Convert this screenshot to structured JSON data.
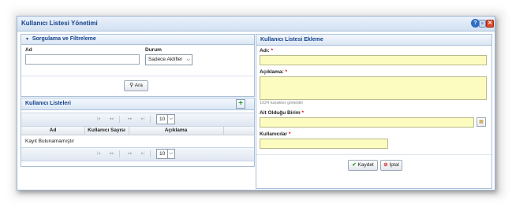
{
  "window": {
    "title": "Kullanıcı Listesi Yönetimi"
  },
  "filter": {
    "header": "Sorgulama ve Filtreleme",
    "ad_label": "Ad",
    "ad_value": "",
    "durum_label": "Durum",
    "durum_value": "Sadece Aktifler",
    "search_label": "Ara"
  },
  "list": {
    "header": "Kullanıcı Listeleri",
    "page_size": "10",
    "columns": [
      "Ad",
      "Kullanıcı Sayısı",
      "Açıklama"
    ],
    "empty_text": "Kayıt Bulunamamıştır"
  },
  "form": {
    "header": "Kullanıcı Listesi Ekleme",
    "adi_label": "Adı:",
    "aciklama_label": "Açıklama:",
    "char_hint": "1024 karakter girilebilir",
    "birim_label": "Ait Olduğu Birim",
    "kullanicilar_label": "Kullanıcılar",
    "required_mark": "*",
    "save_label": "Kaydet",
    "cancel_label": "İptal"
  },
  "colors": {
    "header_text": "#15428b",
    "required_field": "#fdfcc0",
    "close_button": "#e04a2b",
    "add_icon": "#1b9a2a"
  }
}
